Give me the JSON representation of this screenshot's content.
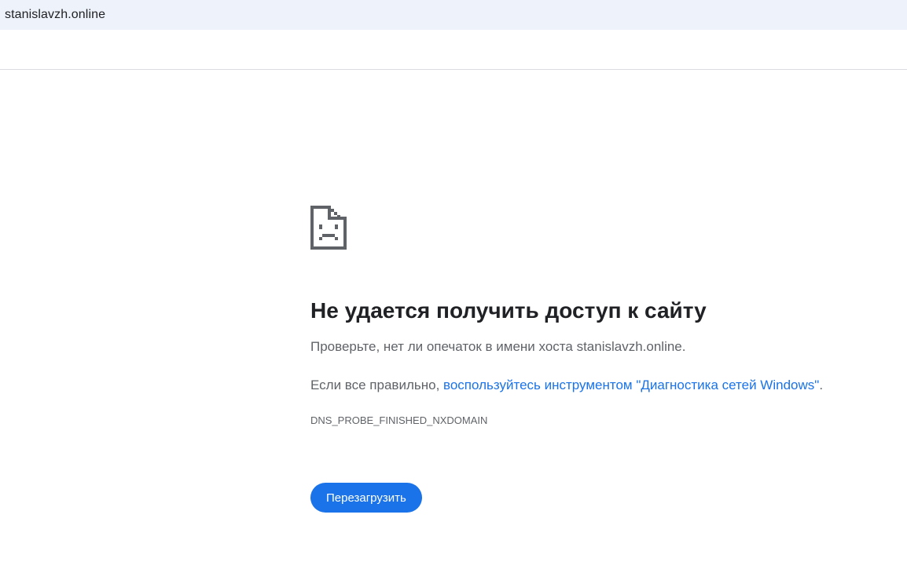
{
  "address_bar": {
    "url": "stanislavzh.online"
  },
  "error_page": {
    "icon": "sad-page-icon",
    "title": "Не удается получить доступ к сайту",
    "check_text": "Проверьте, нет ли опечаток в имени хоста stanislavzh.online.",
    "hint_prefix": "Если все правильно, ",
    "diagnostics_link": "воспользуйтесь инструментом \"Диагностика сетей Windows\"",
    "hint_suffix": ".",
    "error_code": "DNS_PROBE_FINISHED_NXDOMAIN",
    "reload_label": "Перезагрузить"
  },
  "colors": {
    "accent": "#1a73e8",
    "address_bar_bg": "#eef2fb",
    "text_primary": "#202124",
    "text_secondary": "#5f6368"
  }
}
